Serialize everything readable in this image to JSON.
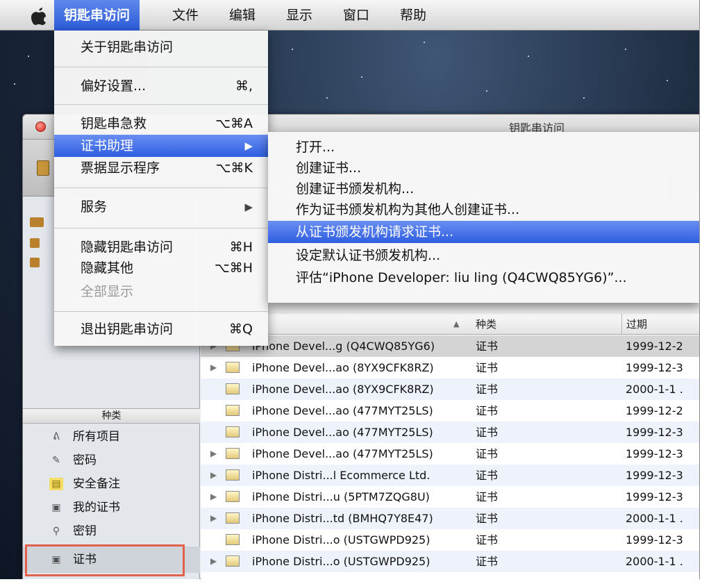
{
  "menubar": {
    "apple": "",
    "items": [
      "钥匙串访问",
      "文件",
      "编辑",
      "显示",
      "窗口",
      "帮助"
    ]
  },
  "window": {
    "title": "钥匙串访问"
  },
  "app_menu": {
    "about": "关于钥匙串访问",
    "prefs": "偏好设置...",
    "prefs_sc": "⌘,",
    "first_aid": "钥匙串急救",
    "first_aid_sc": "⌥⌘A",
    "cert_assistant": "证书助理",
    "ticket_viewer": "票据显示程序",
    "ticket_viewer_sc": "⌥⌘K",
    "services": "服务",
    "hide": "隐藏钥匙串访问",
    "hide_sc": "⌘H",
    "hide_others": "隐藏其他",
    "hide_others_sc": "⌥⌘H",
    "show_all": "全部显示",
    "quit": "退出钥匙串访问",
    "quit_sc": "⌘Q"
  },
  "submenu": {
    "items": [
      "打开...",
      "创建证书...",
      "创建证书颁发机构...",
      "作为证书颁发机构为其他人创建证书...",
      "从证书颁发机构请求证书...",
      "设定默认证书颁发机构...",
      "评估“iPhone Developer: liu ling (Q4CWQ85YG6)”..."
    ]
  },
  "sidebar": {
    "category_header": "种类",
    "categories": [
      {
        "label": "所有项目",
        "icon": "person-icon"
      },
      {
        "label": "密码",
        "icon": "pencil-icon"
      },
      {
        "label": "安全备注",
        "icon": "note-icon"
      },
      {
        "label": "我的证书",
        "icon": "certificate-icon"
      },
      {
        "label": "密钥",
        "icon": "key-icon"
      },
      {
        "label": "证书",
        "icon": "certificate-icon"
      }
    ]
  },
  "list": {
    "headers": {
      "kind": "种类",
      "expires": "过期"
    },
    "rows": [
      {
        "name": "iPhone Devel...g (Q4CWQ85YG6)",
        "kind": "证书",
        "expires": "1999-12-2"
      },
      {
        "name": "iPhone Devel...ao (8YX9CFK8RZ)",
        "kind": "证书",
        "expires": "1999-12-3"
      },
      {
        "name": "iPhone Devel...ao (8YX9CFK8RZ)",
        "kind": "证书",
        "expires": "2000-1-1 ."
      },
      {
        "name": "iPhone Devel...ao (477MYT25LS)",
        "kind": "证书",
        "expires": "1999-12-2"
      },
      {
        "name": "iPhone Devel...ao (477MYT25LS)",
        "kind": "证书",
        "expires": "1999-12-3"
      },
      {
        "name": "iPhone Devel...ao (477MYT25LS)",
        "kind": "证书",
        "expires": "1999-12-3"
      },
      {
        "name": "iPhone Distri...l Ecommerce Ltd.",
        "kind": "证书",
        "expires": "1999-12-3"
      },
      {
        "name": "iPhone Distri...u (5PTM7ZQG8U)",
        "kind": "证书",
        "expires": "1999-12-3"
      },
      {
        "name": "iPhone Distri...td (BMHQ7Y8E47)",
        "kind": "证书",
        "expires": "2000-1-1 ."
      },
      {
        "name": "iPhone Distri...o (USTGWPD925)",
        "kind": "证书",
        "expires": "1999-12-3"
      },
      {
        "name": "iPhone Distri...o (USTGWPD925)",
        "kind": "证书",
        "expires": "2000-1-1 ."
      }
    ]
  }
}
